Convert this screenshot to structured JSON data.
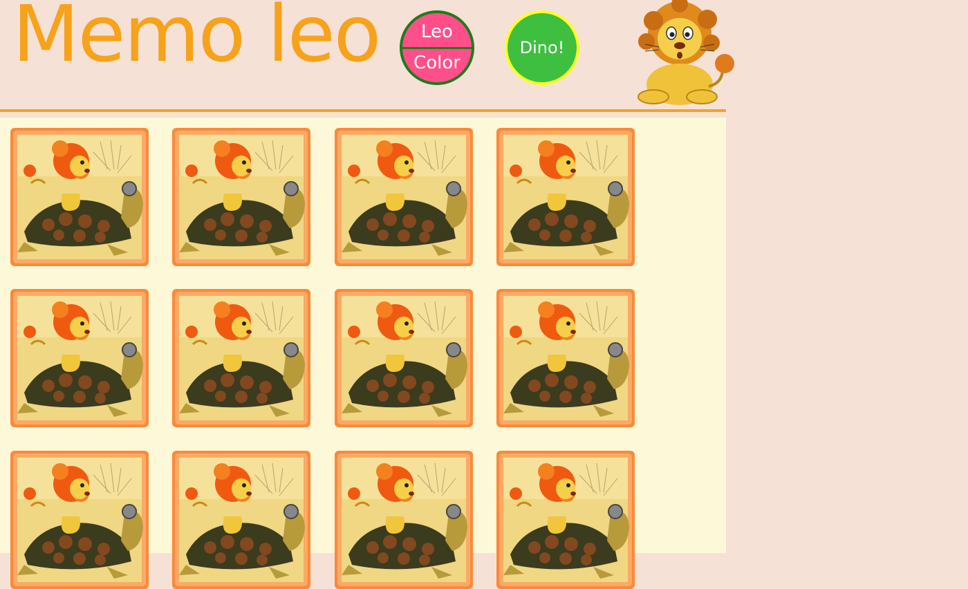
{
  "header": {
    "logo_text": "Memo leo",
    "buttons": {
      "leo_color_top": "Leo",
      "leo_color_bottom": "Color",
      "dino": "Dino!"
    }
  },
  "board": {
    "rows": 3,
    "cols": 4,
    "card_back": "lion-riding-turtle-image"
  },
  "colors": {
    "accent": "#f7a21b",
    "header_bg": "#f5e1d5",
    "board_bg": "#fdf9d8",
    "pink_button": "#ff4f8b",
    "green_button": "#3fbf3f"
  }
}
